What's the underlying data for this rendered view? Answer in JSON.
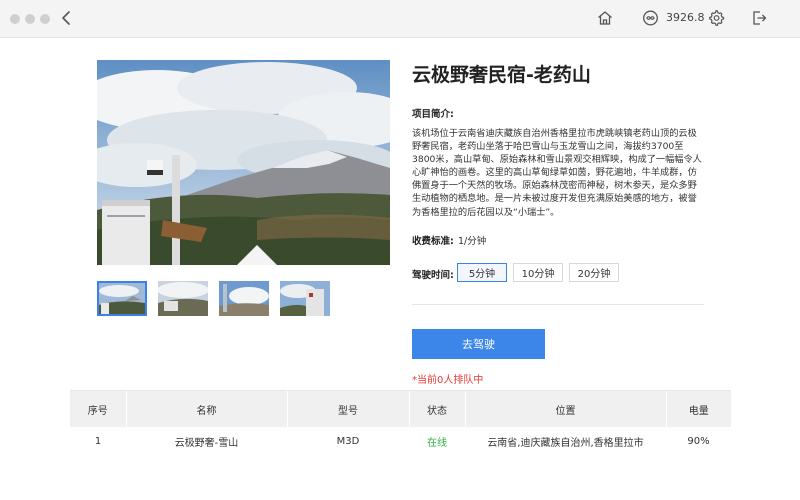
{
  "topbar": {
    "back_icon": "chevron-left-icon",
    "home_icon": "home-icon",
    "coin_icon": "coin-icon",
    "balance": "3926.8",
    "settings_icon": "gear-icon",
    "logout_icon": "logout-icon"
  },
  "gallery": {
    "main_image": "mountain-landscape-photo",
    "thumbnails": [
      "thumbnail-1",
      "thumbnail-2",
      "thumbnail-3",
      "thumbnail-4"
    ],
    "selected_index": 0
  },
  "project": {
    "title": "云极野奢民宿-老药山",
    "intro_label": "项目简介:",
    "description": "该机场位于云南省迪庆藏族自治州香格里拉市虎跳峡镇老药山顶的云极野奢民宿，老药山坐落于哈巴雪山与玉龙雪山之间，海拔约3700至3800米，高山草甸、原始森林和雪山景观交相辉映，构成了一幅幅令人心旷神怡的画卷。这里的高山草甸绿草如茵，野花遍地，牛羊成群，仿佛置身于一个天然的牧场。原始森林茂密而神秘，树木参天，是众多野生动植物的栖息地。是一片未被过度开发但充满原始美感的地方，被誉为香格里拉的后花园以及“小瑞士”。",
    "fee_label": "收费标准:",
    "fee_value": "1/分钟",
    "drive_time_label": "驾驶时间:",
    "drive_options": [
      "5分钟",
      "10分钟",
      "20分钟"
    ],
    "selected_option": 0,
    "drive_button": "去驾驶",
    "queue_status": "*当前0人排队中"
  },
  "table": {
    "headers": [
      "序号",
      "名称",
      "型号",
      "状态",
      "位置",
      "电量"
    ],
    "rows": [
      [
        "1",
        "云极野奢-雪山",
        "M3D",
        "在线",
        "云南省,迪庆藏族自治州,香格里拉市",
        "90%"
      ]
    ]
  },
  "colors": {
    "accent": "#3c86ea",
    "online": "#2fb344",
    "alert": "#e53935"
  }
}
